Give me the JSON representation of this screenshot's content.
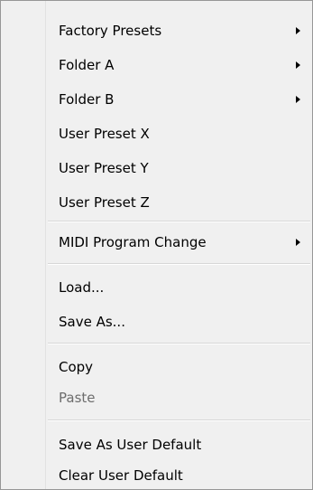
{
  "menu": {
    "items": [
      {
        "label": "Factory Presets",
        "submenu": true
      },
      {
        "label": "Folder A",
        "submenu": true
      },
      {
        "label": "Folder B",
        "submenu": true
      },
      {
        "label": "User Preset X",
        "submenu": false
      },
      {
        "label": "User Preset Y",
        "submenu": false
      },
      {
        "label": "User Preset Z",
        "submenu": false
      },
      {
        "label": "MIDI Program Change",
        "submenu": true
      },
      {
        "label": "Load...",
        "submenu": false
      },
      {
        "label": "Save As...",
        "submenu": false
      },
      {
        "label": "Copy",
        "submenu": false
      },
      {
        "label": "Paste",
        "submenu": false,
        "disabled": true
      },
      {
        "label": "Save As User Default",
        "submenu": false
      },
      {
        "label": "Clear User Default",
        "submenu": false
      }
    ],
    "submenu_arrow_icon": "chevron-right-icon",
    "colors": {
      "background": "#f0f0f0",
      "border": "#979797",
      "text": "#000000",
      "disabled_text": "#6d6d6d",
      "separator": "#d7d7d7"
    }
  }
}
